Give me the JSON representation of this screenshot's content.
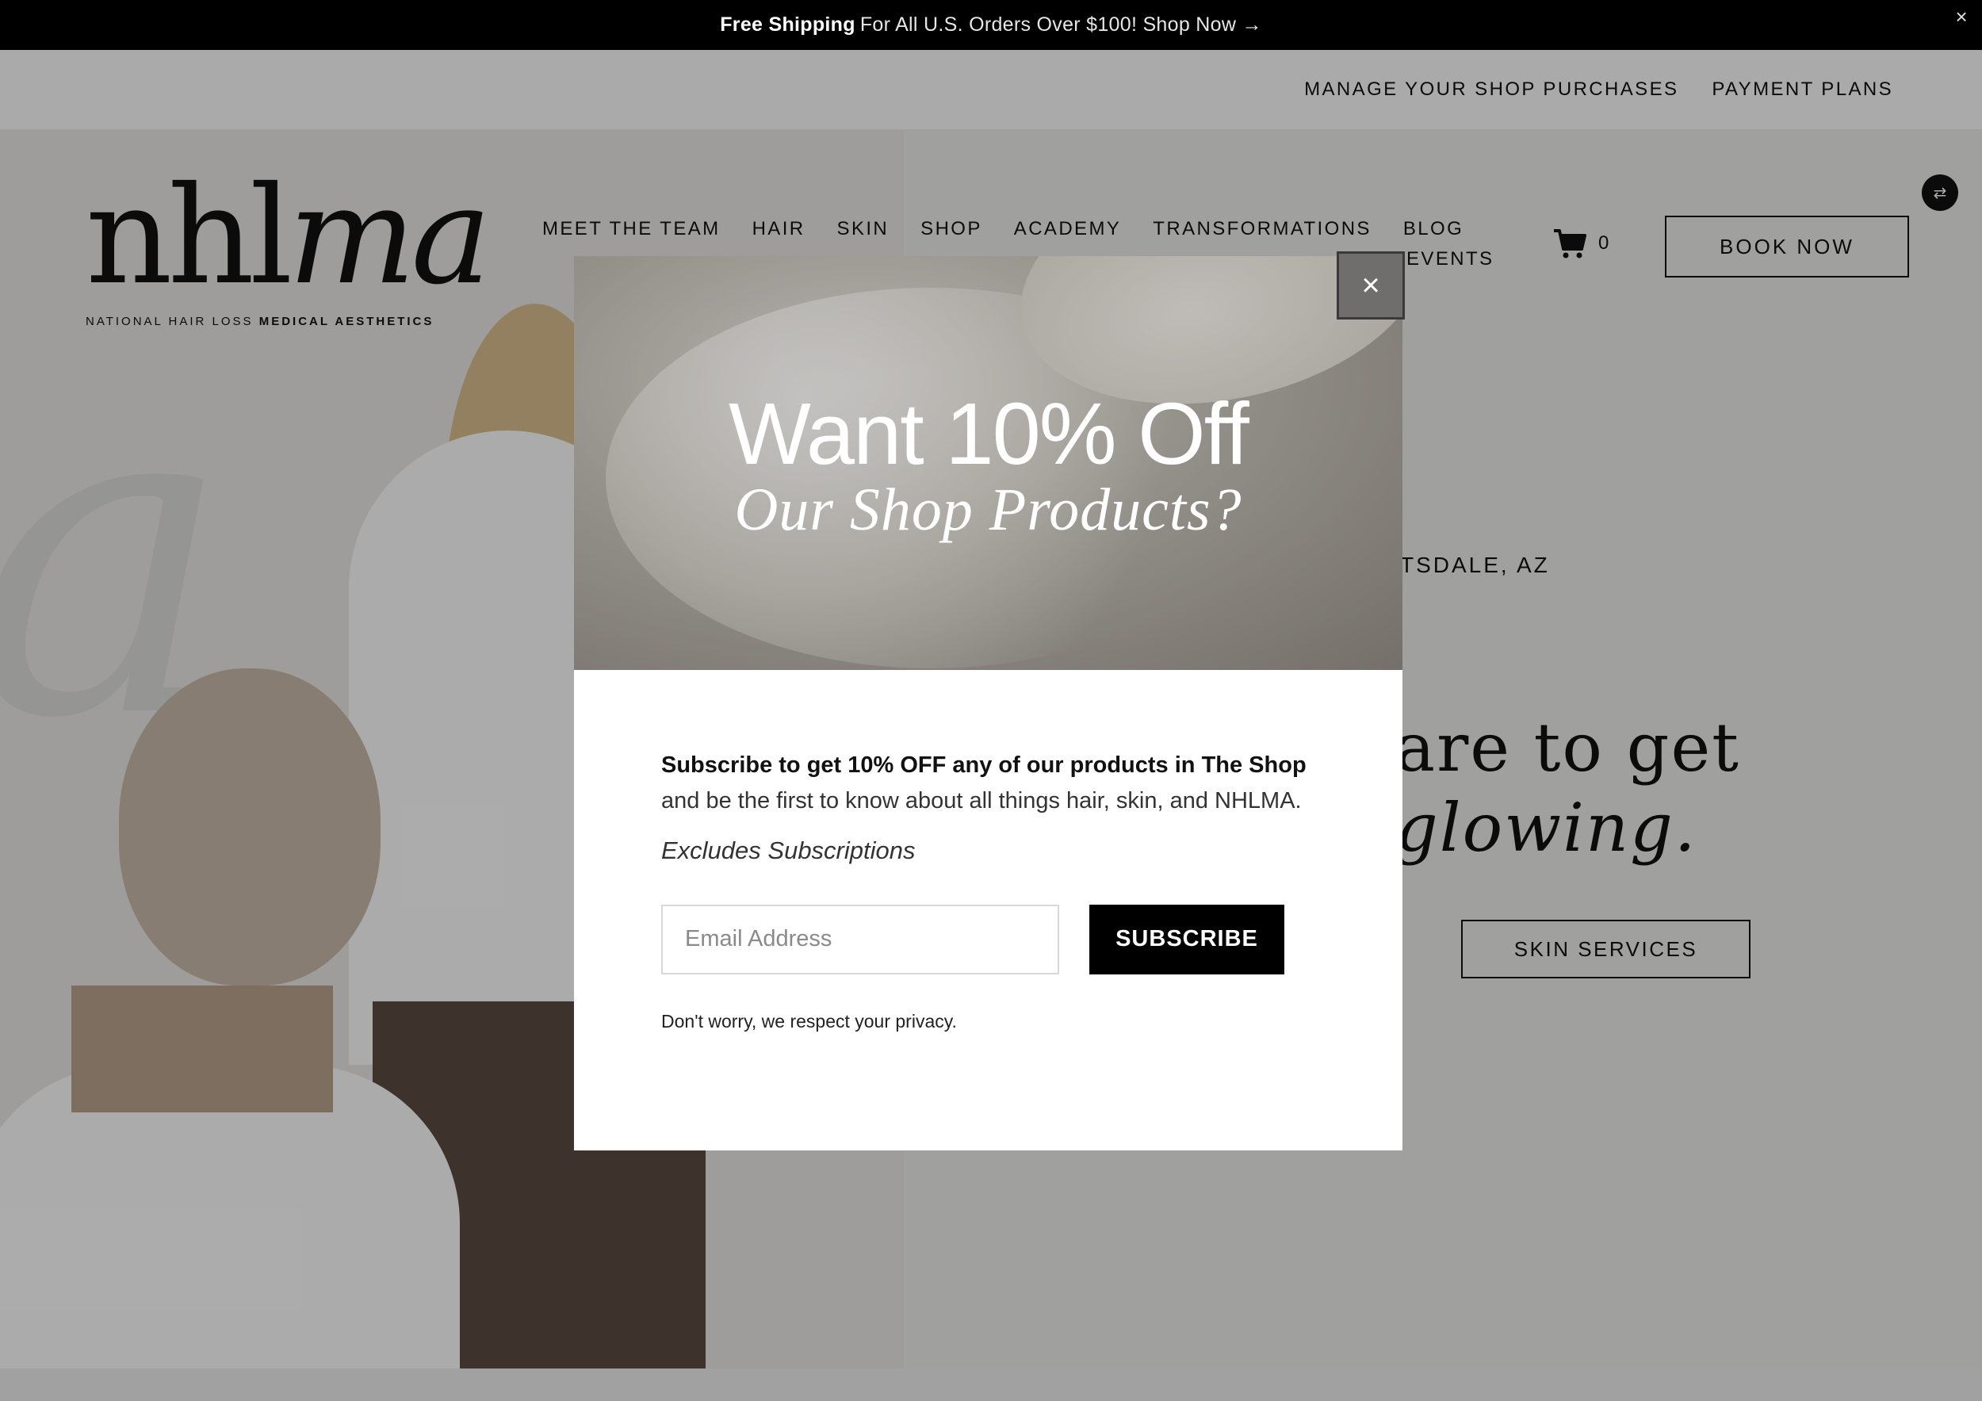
{
  "announcement": {
    "bold": "Free Shipping",
    "text": "For All U.S. Orders Over $100! Shop Now →",
    "close": "×"
  },
  "utility_nav": {
    "items": [
      "MANAGE YOUR SHOP PURCHASES",
      "PAYMENT PLANS"
    ]
  },
  "logo": {
    "word_upright": "nhl",
    "word_italic": "ma",
    "tag_regular": "NATIONAL HAIR LOSS",
    "tag_bold": "MEDICAL AESTHETICS"
  },
  "main_nav": {
    "items": [
      "MEET THE TEAM",
      "HAIR",
      "SKIN",
      "SHOP",
      "ACADEMY",
      "TRANSFORMATIONS",
      "BLOG"
    ],
    "second_row": "EVENTS"
  },
  "cart": {
    "count": "0"
  },
  "book_now": "BOOK NOW",
  "hero": {
    "location": "TSDALE, AZ",
    "headline_line1": "are to get",
    "headline_line2": "glowing.",
    "skin_button": "SKIN SERVICES"
  },
  "modal": {
    "title": "Want 10% Off",
    "subtitle": "Our Shop Products?",
    "close": "×",
    "desc_bold": "Subscribe to get 10% OFF any of our products in The Shop",
    "desc_rest": " and be the first to know about all things hair, skin, and NHLMA.",
    "note": "Excludes Subscriptions",
    "email_placeholder": "Email Address",
    "email_value": "",
    "subscribe_label": "SUBSCRIBE",
    "privacy": "Don't worry, we respect your privacy."
  },
  "colors": {
    "announcement_bg": "#000000",
    "accent": "#111111",
    "overlay": "rgba(0,0,0,0.32)"
  }
}
